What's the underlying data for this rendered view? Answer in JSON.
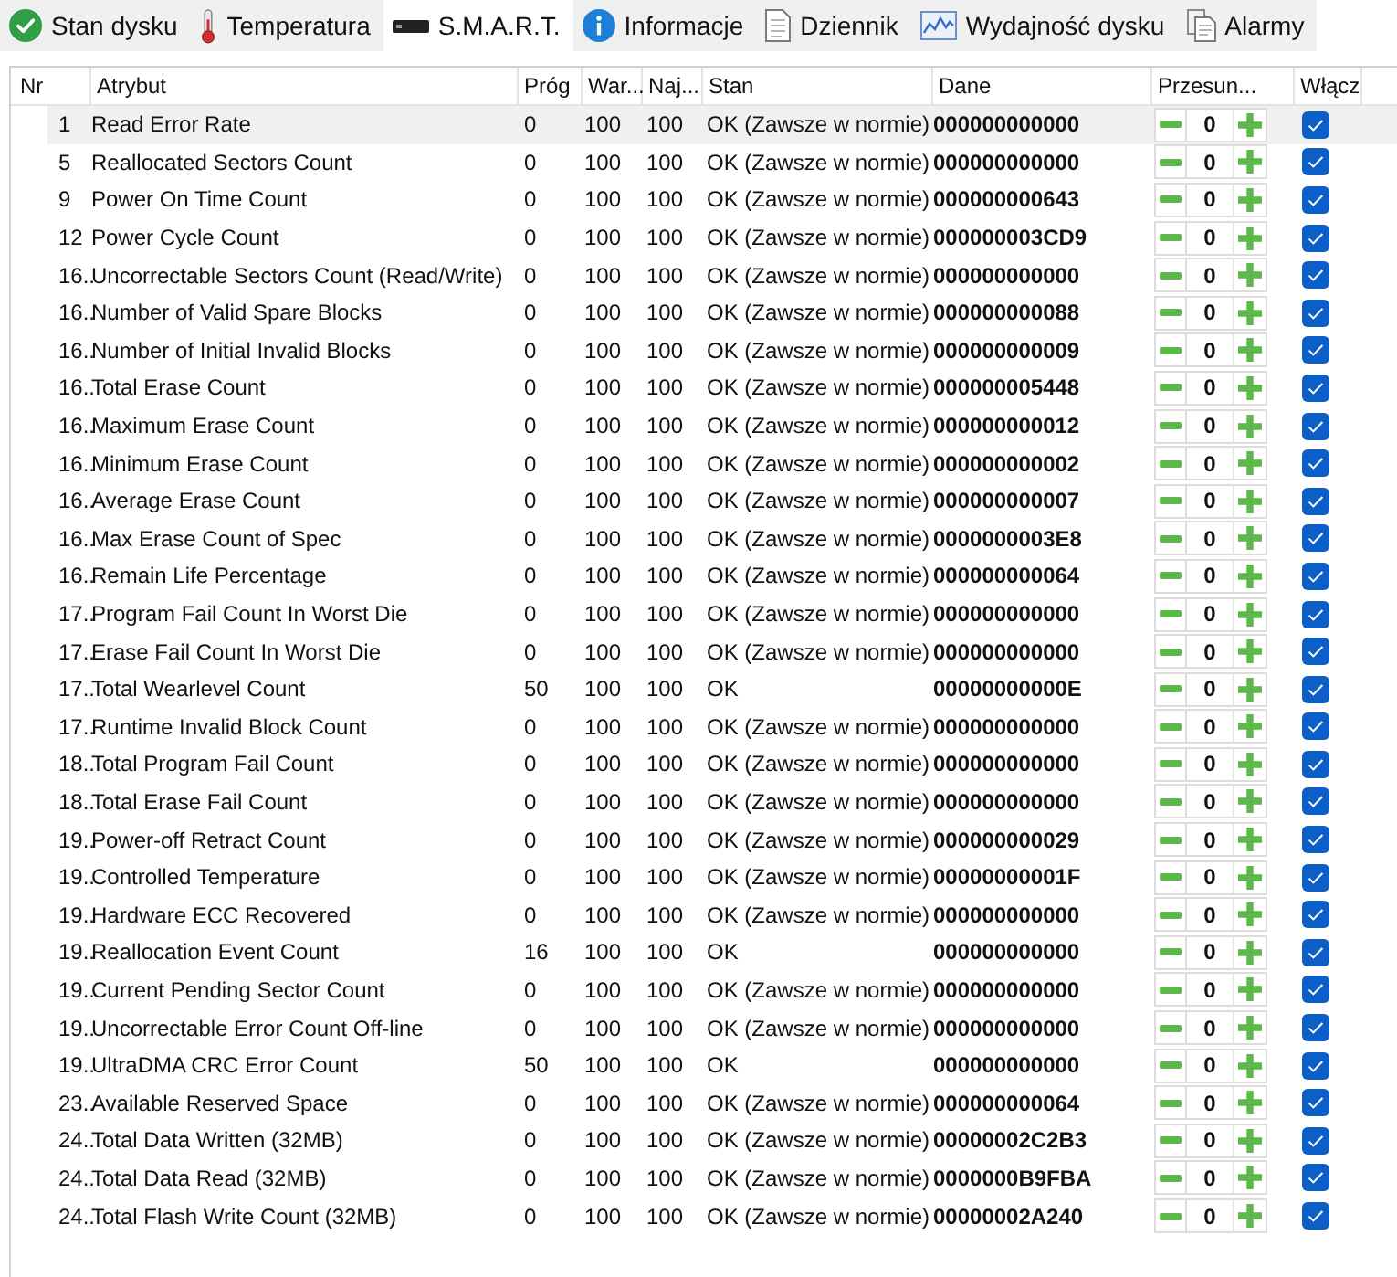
{
  "tabs": [
    {
      "label": "Stan dysku",
      "selected": false
    },
    {
      "label": "Temperatura",
      "selected": false
    },
    {
      "label": "S.M.A.R.T.",
      "selected": true
    },
    {
      "label": "Informacje",
      "selected": false
    },
    {
      "label": "Dziennik",
      "selected": false
    },
    {
      "label": "Wydajność dysku",
      "selected": false
    },
    {
      "label": "Alarmy",
      "selected": false
    }
  ],
  "table": {
    "columns": [
      "Nr",
      "Atrybut",
      "Próg",
      "War...",
      "Naj...",
      "Stan",
      "Dane",
      "Przesun...",
      "Włącz"
    ],
    "rows": [
      {
        "nr": "1",
        "atrybut": "Read Error Rate",
        "prog": "0",
        "war": "100",
        "naj": "100",
        "stan": "OK (Zawsze w normie)",
        "dane": "000000000000",
        "przesun": "0",
        "checked": true,
        "selected": true
      },
      {
        "nr": "5",
        "atrybut": "Reallocated Sectors Count",
        "prog": "0",
        "war": "100",
        "naj": "100",
        "stan": "OK (Zawsze w normie)",
        "dane": "000000000000",
        "przesun": "0",
        "checked": true,
        "selected": false
      },
      {
        "nr": "9",
        "atrybut": "Power On Time Count",
        "prog": "0",
        "war": "100",
        "naj": "100",
        "stan": "OK (Zawsze w normie)",
        "dane": "000000000643",
        "przesun": "0",
        "checked": true,
        "selected": false
      },
      {
        "nr": "12",
        "atrybut": "Power Cycle Count",
        "prog": "0",
        "war": "100",
        "naj": "100",
        "stan": "OK (Zawsze w normie)",
        "dane": "000000003CD9",
        "przesun": "0",
        "checked": true,
        "selected": false
      },
      {
        "nr": "16..",
        "atrybut": "Uncorrectable Sectors Count (Read/Write)",
        "prog": "0",
        "war": "100",
        "naj": "100",
        "stan": "OK (Zawsze w normie)",
        "dane": "000000000000",
        "przesun": "0",
        "checked": true,
        "selected": false
      },
      {
        "nr": "16..",
        "atrybut": "Number of Valid Spare Blocks",
        "prog": "0",
        "war": "100",
        "naj": "100",
        "stan": "OK (Zawsze w normie)",
        "dane": "000000000088",
        "przesun": "0",
        "checked": true,
        "selected": false
      },
      {
        "nr": "16..",
        "atrybut": "Number of Initial Invalid Blocks",
        "prog": "0",
        "war": "100",
        "naj": "100",
        "stan": "OK (Zawsze w normie)",
        "dane": "000000000009",
        "przesun": "0",
        "checked": true,
        "selected": false
      },
      {
        "nr": "16..",
        "atrybut": "Total Erase Count",
        "prog": "0",
        "war": "100",
        "naj": "100",
        "stan": "OK (Zawsze w normie)",
        "dane": "000000005448",
        "przesun": "0",
        "checked": true,
        "selected": false
      },
      {
        "nr": "16..",
        "atrybut": "Maximum Erase Count",
        "prog": "0",
        "war": "100",
        "naj": "100",
        "stan": "OK (Zawsze w normie)",
        "dane": "000000000012",
        "przesun": "0",
        "checked": true,
        "selected": false
      },
      {
        "nr": "16..",
        "atrybut": "Minimum Erase Count",
        "prog": "0",
        "war": "100",
        "naj": "100",
        "stan": "OK (Zawsze w normie)",
        "dane": "000000000002",
        "przesun": "0",
        "checked": true,
        "selected": false
      },
      {
        "nr": "16..",
        "atrybut": "Average Erase Count",
        "prog": "0",
        "war": "100",
        "naj": "100",
        "stan": "OK (Zawsze w normie)",
        "dane": "000000000007",
        "przesun": "0",
        "checked": true,
        "selected": false
      },
      {
        "nr": "16..",
        "atrybut": "Max Erase Count of Spec",
        "prog": "0",
        "war": "100",
        "naj": "100",
        "stan": "OK (Zawsze w normie)",
        "dane": "0000000003E8",
        "przesun": "0",
        "checked": true,
        "selected": false
      },
      {
        "nr": "16..",
        "atrybut": "Remain Life Percentage",
        "prog": "0",
        "war": "100",
        "naj": "100",
        "stan": "OK (Zawsze w normie)",
        "dane": "000000000064",
        "przesun": "0",
        "checked": true,
        "selected": false
      },
      {
        "nr": "17..",
        "atrybut": "Program Fail Count In Worst Die",
        "prog": "0",
        "war": "100",
        "naj": "100",
        "stan": "OK (Zawsze w normie)",
        "dane": "000000000000",
        "przesun": "0",
        "checked": true,
        "selected": false
      },
      {
        "nr": "17..",
        "atrybut": "Erase Fail Count In Worst Die",
        "prog": "0",
        "war": "100",
        "naj": "100",
        "stan": "OK (Zawsze w normie)",
        "dane": "000000000000",
        "przesun": "0",
        "checked": true,
        "selected": false
      },
      {
        "nr": "17..",
        "atrybut": "Total Wearlevel Count",
        "prog": "50",
        "war": "100",
        "naj": "100",
        "stan": "OK",
        "dane": "00000000000E",
        "przesun": "0",
        "checked": true,
        "selected": false
      },
      {
        "nr": "17..",
        "atrybut": "Runtime Invalid Block Count",
        "prog": "0",
        "war": "100",
        "naj": "100",
        "stan": "OK (Zawsze w normie)",
        "dane": "000000000000",
        "przesun": "0",
        "checked": true,
        "selected": false
      },
      {
        "nr": "18..",
        "atrybut": "Total Program Fail Count",
        "prog": "0",
        "war": "100",
        "naj": "100",
        "stan": "OK (Zawsze w normie)",
        "dane": "000000000000",
        "przesun": "0",
        "checked": true,
        "selected": false
      },
      {
        "nr": "18..",
        "atrybut": "Total Erase Fail Count",
        "prog": "0",
        "war": "100",
        "naj": "100",
        "stan": "OK (Zawsze w normie)",
        "dane": "000000000000",
        "przesun": "0",
        "checked": true,
        "selected": false
      },
      {
        "nr": "19..",
        "atrybut": "Power-off Retract Count",
        "prog": "0",
        "war": "100",
        "naj": "100",
        "stan": "OK (Zawsze w normie)",
        "dane": "000000000029",
        "przesun": "0",
        "checked": true,
        "selected": false
      },
      {
        "nr": "19..",
        "atrybut": "Controlled Temperature",
        "prog": "0",
        "war": "100",
        "naj": "100",
        "stan": "OK (Zawsze w normie)",
        "dane": "00000000001F",
        "przesun": "0",
        "checked": true,
        "selected": false
      },
      {
        "nr": "19..",
        "atrybut": "Hardware ECC Recovered",
        "prog": "0",
        "war": "100",
        "naj": "100",
        "stan": "OK (Zawsze w normie)",
        "dane": "000000000000",
        "przesun": "0",
        "checked": true,
        "selected": false
      },
      {
        "nr": "19..",
        "atrybut": "Reallocation Event Count",
        "prog": "16",
        "war": "100",
        "naj": "100",
        "stan": "OK",
        "dane": "000000000000",
        "przesun": "0",
        "checked": true,
        "selected": false
      },
      {
        "nr": "19..",
        "atrybut": "Current Pending Sector Count",
        "prog": "0",
        "war": "100",
        "naj": "100",
        "stan": "OK (Zawsze w normie)",
        "dane": "000000000000",
        "przesun": "0",
        "checked": true,
        "selected": false
      },
      {
        "nr": "19..",
        "atrybut": "Uncorrectable Error Count Off-line",
        "prog": "0",
        "war": "100",
        "naj": "100",
        "stan": "OK (Zawsze w normie)",
        "dane": "000000000000",
        "przesun": "0",
        "checked": true,
        "selected": false
      },
      {
        "nr": "19..",
        "atrybut": "UltraDMA CRC Error Count",
        "prog": "50",
        "war": "100",
        "naj": "100",
        "stan": "OK",
        "dane": "000000000000",
        "przesun": "0",
        "checked": true,
        "selected": false
      },
      {
        "nr": "23..",
        "atrybut": "Available Reserved Space",
        "prog": "0",
        "war": "100",
        "naj": "100",
        "stan": "OK (Zawsze w normie)",
        "dane": "000000000064",
        "przesun": "0",
        "checked": true,
        "selected": false
      },
      {
        "nr": "24..",
        "atrybut": "Total Data Written (32MB)",
        "prog": "0",
        "war": "100",
        "naj": "100",
        "stan": "OK (Zawsze w normie)",
        "dane": "00000002C2B3",
        "przesun": "0",
        "checked": true,
        "selected": false
      },
      {
        "nr": "24..",
        "atrybut": "Total Data Read (32MB)",
        "prog": "0",
        "war": "100",
        "naj": "100",
        "stan": "OK (Zawsze w normie)",
        "dane": "0000000B9FBA",
        "przesun": "0",
        "checked": true,
        "selected": false
      },
      {
        "nr": "24..",
        "atrybut": "Total Flash Write Count (32MB)",
        "prog": "0",
        "war": "100",
        "naj": "100",
        "stan": "OK (Zawsze w normie)",
        "dane": "00000002A240",
        "przesun": "0",
        "checked": true,
        "selected": false
      }
    ]
  }
}
